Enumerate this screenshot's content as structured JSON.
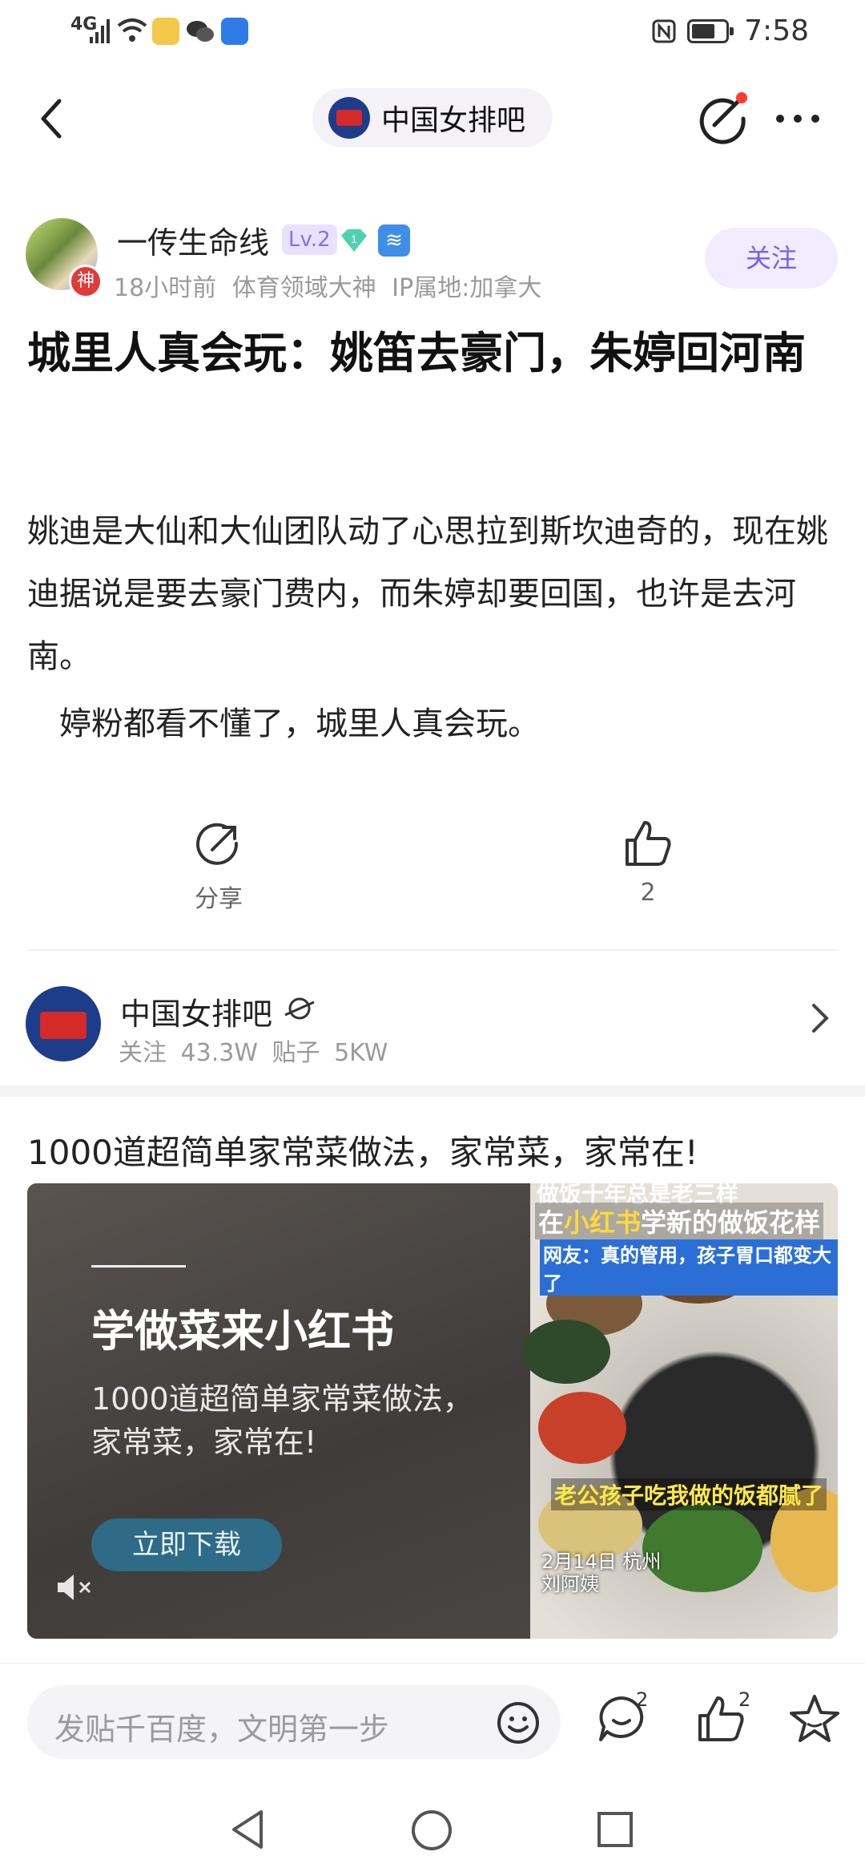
{
  "status_bar": {
    "network": "4G",
    "time": "7:58"
  },
  "top_nav": {
    "forum_name": "中国女排吧"
  },
  "author": {
    "name": "一传生命线",
    "level": "Lv.2",
    "gem_level": "1",
    "badge": "神",
    "time_ago": "18小时前",
    "title": "体育领域大神",
    "ip": "IP属地:加拿大",
    "follow_label": "关注"
  },
  "post": {
    "title": "城里人真会玩：姚笛去豪门，朱婷回河南",
    "paragraph1": "姚迪是大仙和大仙团队动了心思拉到斯坎迪奇的，现在姚迪据说是要去豪门费内，而朱婷却要回国，也许是去河南。",
    "paragraph2": "婷粉都看不懂了，城里人真会玩。",
    "share_label": "分享",
    "like_count": "2"
  },
  "forum_card": {
    "name": "中国女排吧",
    "stats": "关注 43.3W   贴子 5KW"
  },
  "ad": {
    "title": "1000道超简单家常菜做法，家常菜，家常在!",
    "headline": "学做菜来小红书",
    "subline": "1000道超简单家常菜做法，家常菜，家常在!",
    "button": "立即下载",
    "overlay_top": "做饭十年总是老三样",
    "overlay_main_pre": "在",
    "overlay_main_hl": "小红书",
    "overlay_main_post": "学新的做饭花样",
    "overlay_quote": "网友：真的管用，孩子胃口都变大了",
    "overlay_bottom": "老公孩子吃我做的饭都腻了",
    "overlay_date": "2月14日 杭州",
    "overlay_name": "刘阿姨"
  },
  "bottom_bar": {
    "input_placeholder": "发贴千百度，文明第一步",
    "comment_count": "2",
    "like_count": "2"
  }
}
